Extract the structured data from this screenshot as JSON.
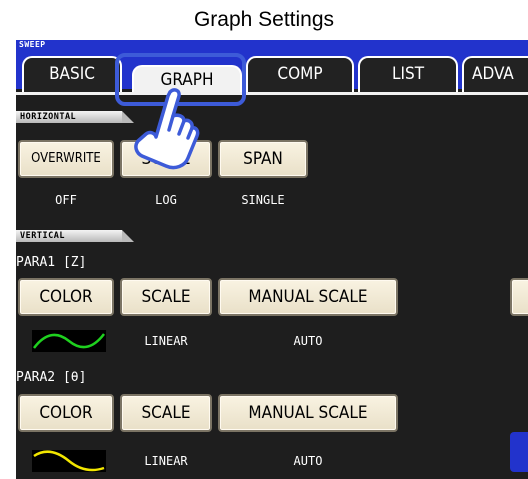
{
  "title": "Graph Settings",
  "screen": {
    "sweep_label": "SWEEP",
    "tabs": [
      {
        "label": "BASIC"
      },
      {
        "label": "GRAPH"
      },
      {
        "label": "COMP"
      },
      {
        "label": "LIST"
      },
      {
        "label": "ADVA"
      }
    ],
    "horizontal": {
      "section_label": "HORIZONTAL",
      "overwrite": {
        "label": "OVERWRITE",
        "value": "OFF"
      },
      "scale": {
        "label": "SCALE",
        "value": "LOG"
      },
      "span": {
        "label": "SPAN",
        "value": "SINGLE"
      }
    },
    "vertical": {
      "section_label": "VERTICAL",
      "para1": {
        "label": "PARA1 [Z]",
        "color_button": "COLOR",
        "scale_button": "SCALE",
        "manual_scale_button": "MANUAL SCALE",
        "scale_value": "LINEAR",
        "manual_scale_value": "AUTO",
        "trace_color": "#1fd11f"
      },
      "para2": {
        "label": "PARA2 [θ]",
        "color_button": "COLOR",
        "scale_button": "SCALE",
        "manual_scale_button": "MANUAL SCALE",
        "scale_value": "LINEAR",
        "manual_scale_value": "AUTO",
        "trace_color": "#f2e600"
      }
    }
  },
  "colors": {
    "header_blue": "#2233cc",
    "highlight": "#3d5bd8",
    "button_face": "#f2ebd6"
  },
  "icons": {
    "pointer": "pointing-hand-icon"
  }
}
